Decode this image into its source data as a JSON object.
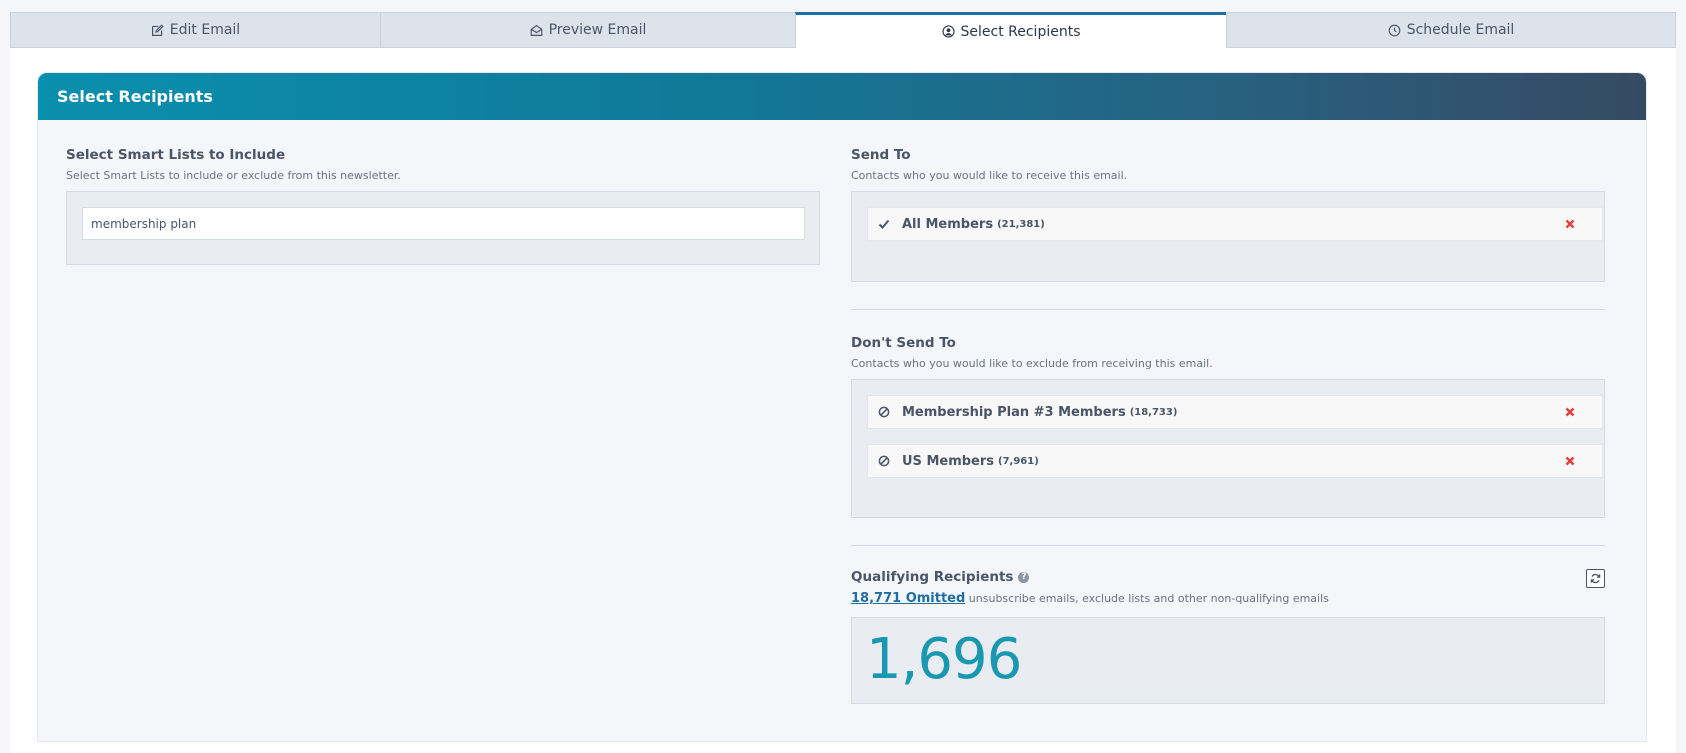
{
  "tabs": [
    {
      "label": "Edit Email",
      "icon": "edit-icon"
    },
    {
      "label": "Preview Email",
      "icon": "envelope-open-icon"
    },
    {
      "label": "Select Recipients",
      "icon": "user-circle-icon",
      "active": true
    },
    {
      "label": "Schedule Email",
      "icon": "clock-icon"
    }
  ],
  "header": {
    "title": "Select Recipients"
  },
  "smart_lists": {
    "title": "Select Smart Lists to Include",
    "subtitle": "Select Smart Lists to include or exclude from this newsletter.",
    "search_value": "membership plan"
  },
  "send_to": {
    "title": "Send To",
    "subtitle": "Contacts who you would like to receive this email.",
    "items": [
      {
        "name": "All Members",
        "count": "(21,381)"
      }
    ]
  },
  "dont_send_to": {
    "title": "Don't Send To",
    "subtitle": "Contacts who you would like to exclude from receiving this email.",
    "items": [
      {
        "name": "Membership Plan #3 Members",
        "count": "(18,733)"
      },
      {
        "name": "US Members",
        "count": "(7,961)"
      }
    ]
  },
  "qualifying": {
    "title": "Qualifying Recipients",
    "help_glyph": "?",
    "omitted_link": "18,771 Omitted",
    "omitted_text": " unsubscribe emails, exclude lists and other non-qualifying emails",
    "total": "1,696"
  },
  "colors": {
    "accent": "#1f6fa3",
    "header_gradient_start": "#0b8fae",
    "header_gradient_end": "#364a63",
    "remove": "#e53e3e",
    "total": "#1a97b1"
  }
}
